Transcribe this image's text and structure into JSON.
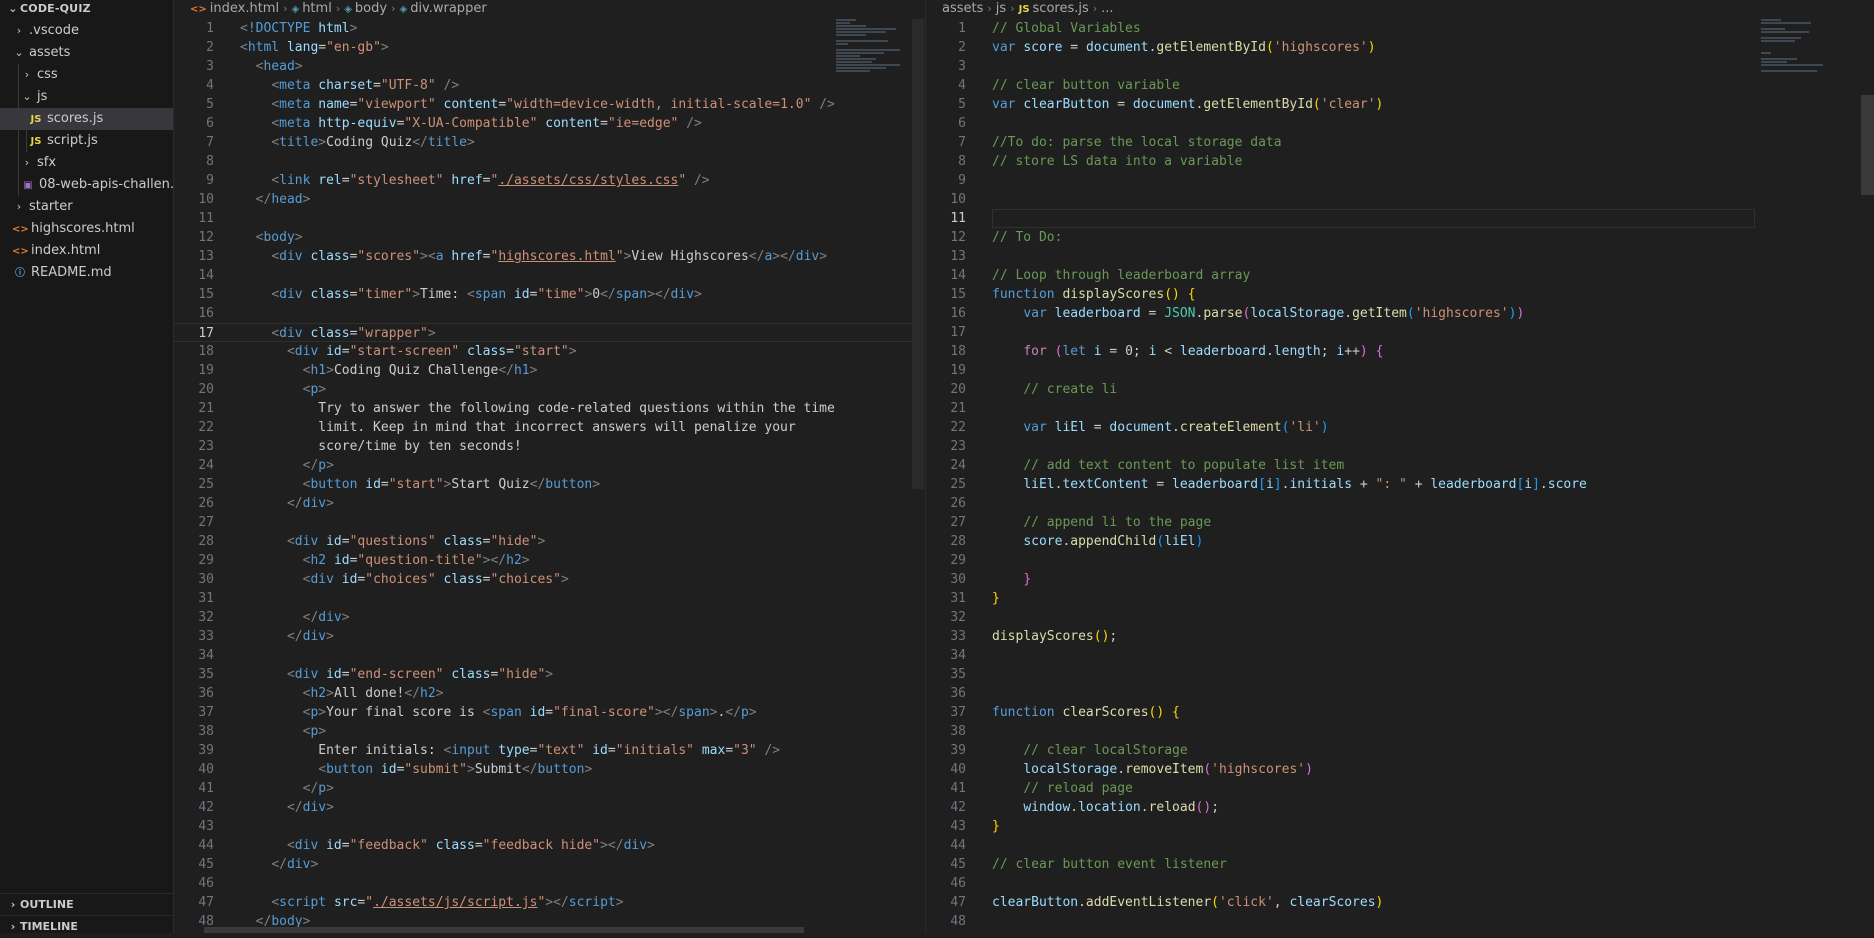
{
  "explorer": {
    "title": "CODE-QUIZ",
    "items": [
      {
        "chev": "›",
        "icon": "",
        "label": ".vscode",
        "depth": 1
      },
      {
        "chev": "⌄",
        "icon": "",
        "label": "assets",
        "depth": 1
      },
      {
        "chev": "›",
        "icon": "",
        "label": "css",
        "depth": 2
      },
      {
        "chev": "⌄",
        "icon": "",
        "label": "js",
        "depth": 2
      },
      {
        "chev": "",
        "icon": "JS",
        "label": "scores.js",
        "depth": 3
      },
      {
        "chev": "",
        "icon": "JS",
        "label": "script.js",
        "depth": 3
      },
      {
        "chev": "›",
        "icon": "",
        "label": "sfx",
        "depth": 2
      },
      {
        "chev": "",
        "icon": "▣",
        "label": "08-web-apis-challen...",
        "depth": 2
      },
      {
        "chev": "›",
        "icon": "",
        "label": "starter",
        "depth": 1
      },
      {
        "chev": "",
        "icon": "<>",
        "label": "highscores.html",
        "depth": 1
      },
      {
        "chev": "",
        "icon": "<>",
        "label": "index.html",
        "depth": 1
      },
      {
        "chev": "",
        "icon": "ⓘ",
        "label": "README.md",
        "depth": 1
      }
    ],
    "outline_label": "OUTLINE",
    "timeline_label": "TIMELINE"
  },
  "left_editor": {
    "crumbs": [
      "index.html",
      "html",
      "body",
      "div.wrapper"
    ],
    "line_numbers": [
      "1",
      "2",
      "3",
      "4",
      "5",
      "6",
      "7",
      "8",
      "9",
      "10",
      "11",
      "12",
      "13",
      "14",
      "15",
      "16",
      "17",
      "18",
      "19",
      "20",
      "21",
      "22",
      "23",
      "24",
      "25",
      "26",
      "27",
      "28",
      "29",
      "30",
      "31",
      "32",
      "33",
      "34",
      "35",
      "36",
      "37",
      "38",
      "39",
      "40",
      "41",
      "42",
      "43",
      "44",
      "45",
      "46",
      "47",
      "48"
    ]
  },
  "right_editor": {
    "crumbs": [
      "assets",
      "js",
      "scores.js",
      "..."
    ],
    "line_numbers": [
      "1",
      "2",
      "3",
      "4",
      "5",
      "6",
      "7",
      "8",
      "9",
      "10",
      "11",
      "12",
      "13",
      "14",
      "15",
      "16",
      "17",
      "18",
      "19",
      "20",
      "21",
      "22",
      "23",
      "24",
      "25",
      "26",
      "27",
      "28",
      "29",
      "30",
      "31",
      "32",
      "33",
      "34",
      "35",
      "36",
      "37",
      "38",
      "39",
      "40",
      "41",
      "42",
      "43",
      "44",
      "45",
      "46",
      "47",
      "48"
    ]
  }
}
